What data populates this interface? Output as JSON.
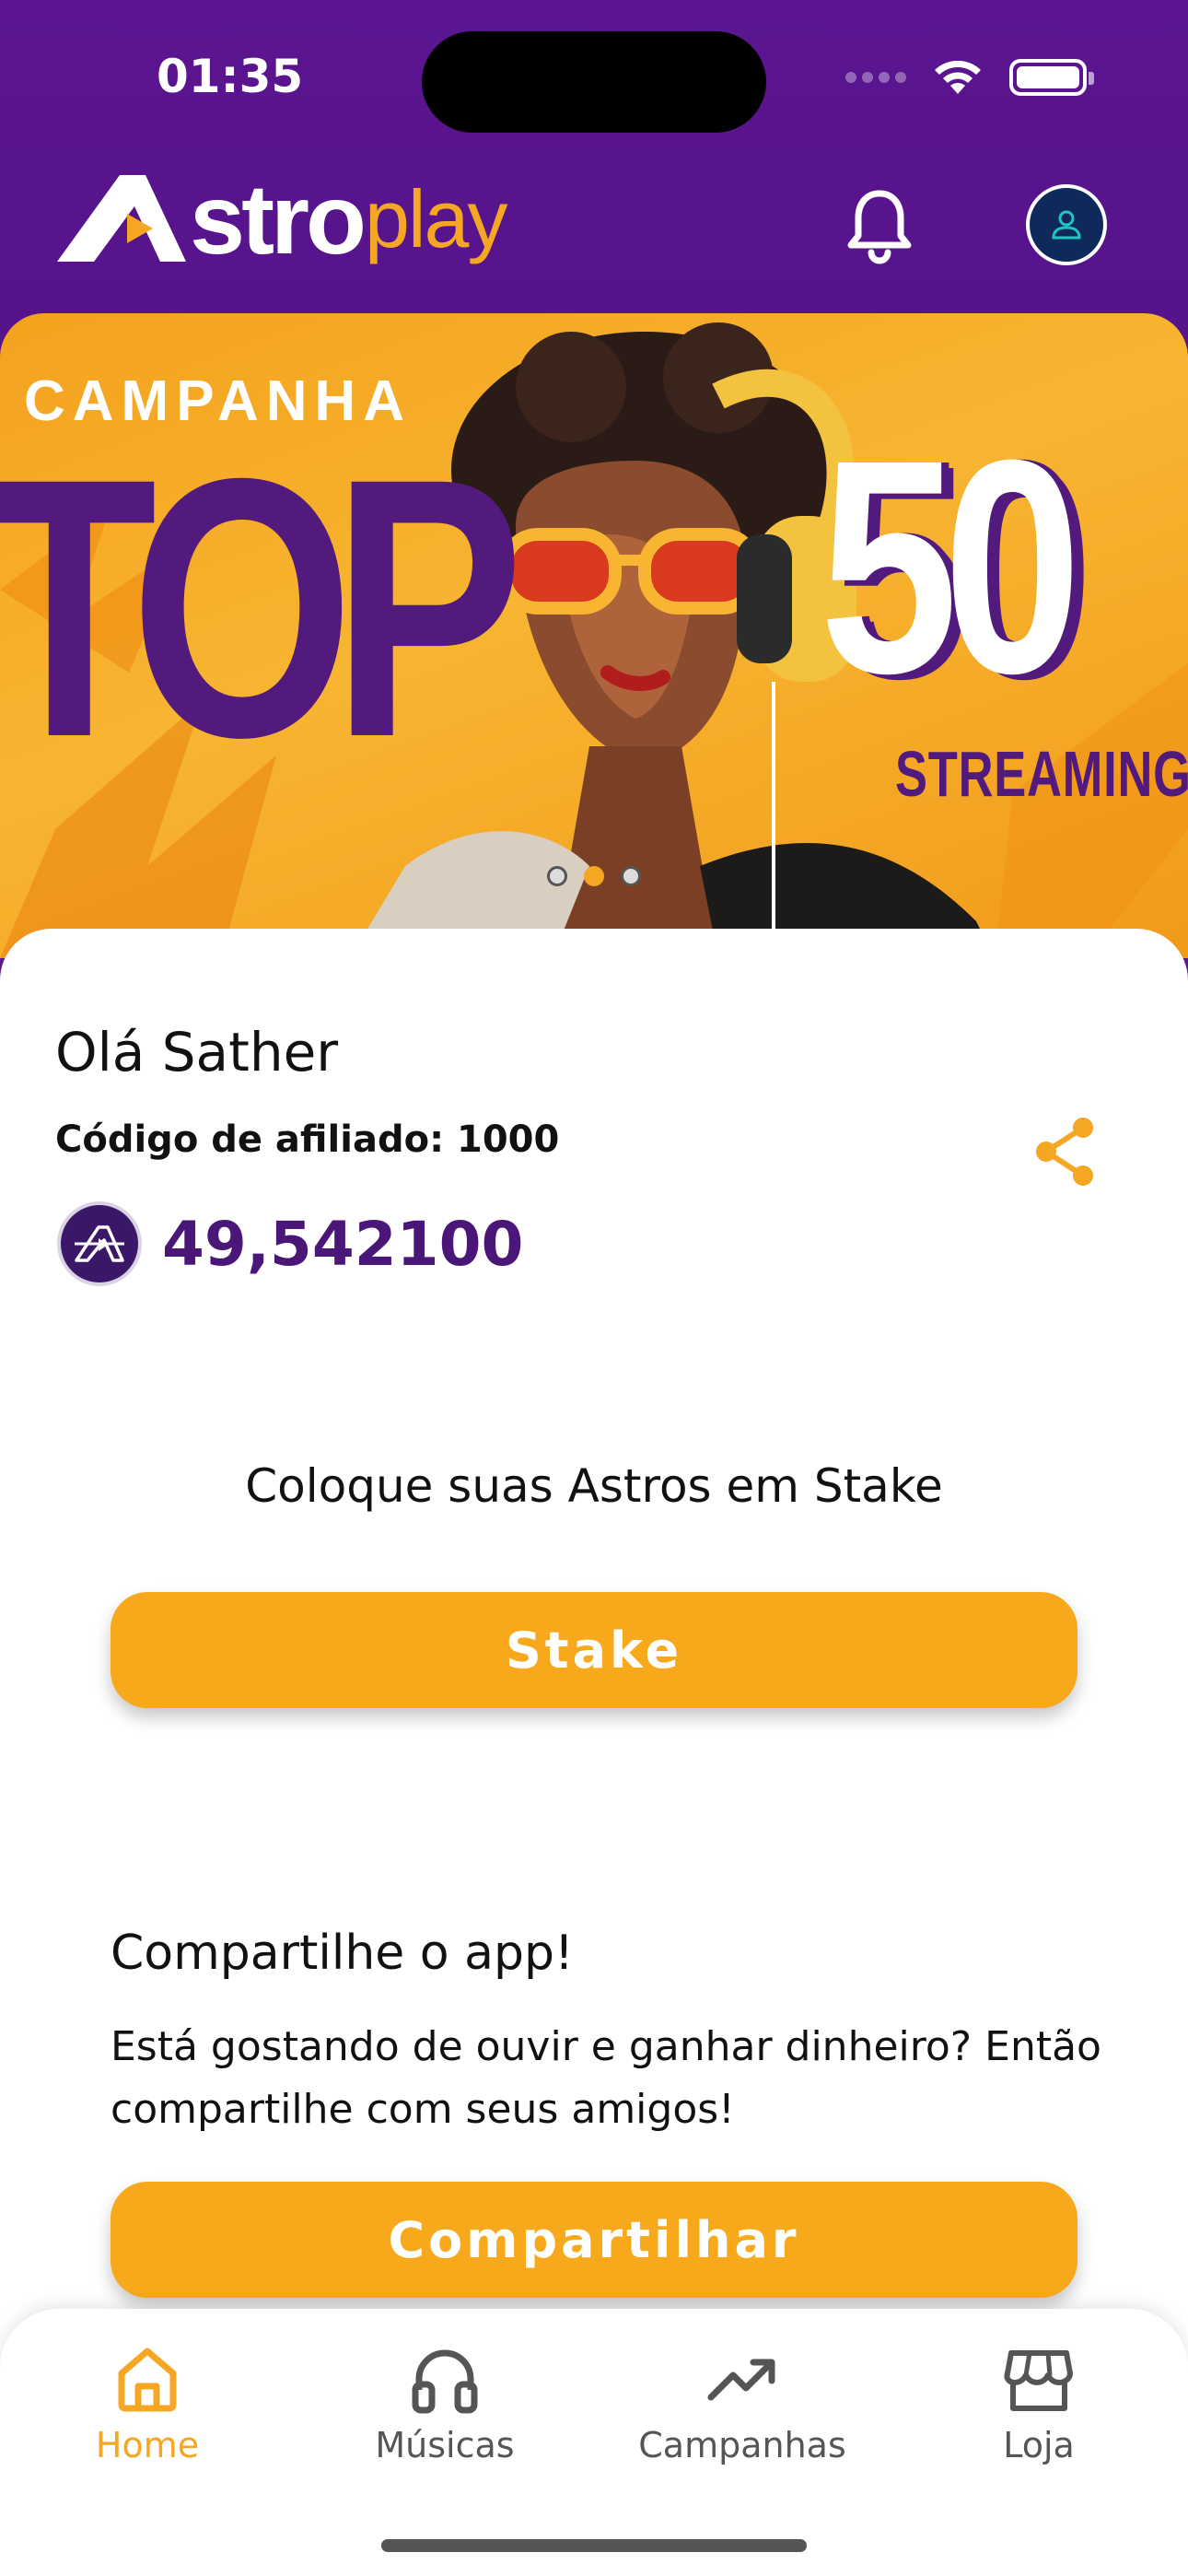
{
  "status_bar": {
    "time": "01:35"
  },
  "header": {
    "logo_main": "Astro",
    "logo_main_visible": "stro",
    "logo_accent": "play",
    "icons": [
      "bell-icon",
      "profile-avatar-icon"
    ]
  },
  "banner": {
    "campaign_label": "CAMPANHA",
    "big_left": "TOP",
    "big_right": "50",
    "subtitle": "STREAMINGS",
    "carousel": {
      "count": 3,
      "active_index": 1
    }
  },
  "profile": {
    "greeting": "Olá Sather",
    "affiliate_label": "Código de afiliado: ",
    "affiliate_code": "1000",
    "balance": "49,542100"
  },
  "stake": {
    "title": "Coloque suas Astros em Stake",
    "button": "Stake"
  },
  "share": {
    "title": "Compartilhe o app!",
    "text": "Está gostando de ouvir e ganhar dinheiro? Então compartilhe com seus amigos!",
    "button": "Compartilhar"
  },
  "tabbar": {
    "items": [
      {
        "label": "Home",
        "icon": "home-icon",
        "active": true
      },
      {
        "label": "Músicas",
        "icon": "headphones-icon",
        "active": false
      },
      {
        "label": "Campanhas",
        "icon": "trending-up-icon",
        "active": false
      },
      {
        "label": "Loja",
        "icon": "store-icon",
        "active": false
      }
    ]
  },
  "colors": {
    "primary_purple": "#55138a",
    "accent_orange": "#f7a81b",
    "balance_purple": "#4a1678"
  }
}
